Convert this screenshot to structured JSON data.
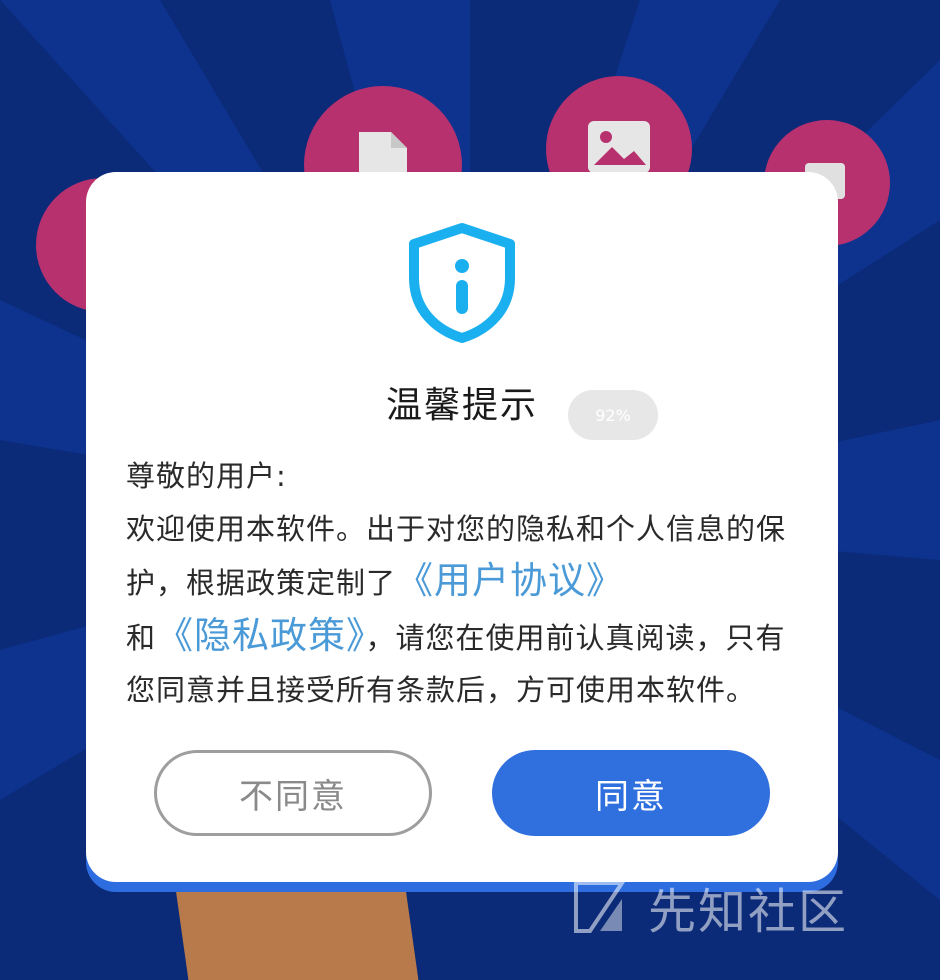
{
  "dialog": {
    "title": "温馨提示",
    "progress_badge": "92%",
    "greeting": "尊敬的用户:",
    "para_1": "欢迎使用本软件。出于对您的隐私和个人信息的保护，根据政策定制了",
    "user_agreement_link": "《用户协议》",
    "and_text": "和",
    "privacy_policy_link": "《隐私政策》",
    "para_2": "，请您在使用前认真阅读，只有您同意并且接受所有条款后，方可使用本软件。",
    "disagree_label": "不同意",
    "agree_label": "同意"
  },
  "watermark": {
    "text": "先知社区"
  },
  "colors": {
    "background": "#0b2a78",
    "bubble": "#b8316f",
    "accent_blue": "#2f6fde",
    "link_blue": "#4b9ad8",
    "shield_blue": "#1ab0f0"
  },
  "icons": [
    "document-icon",
    "image-icon",
    "video-icon",
    "info-shield-icon",
    "watermark-logo-icon"
  ]
}
